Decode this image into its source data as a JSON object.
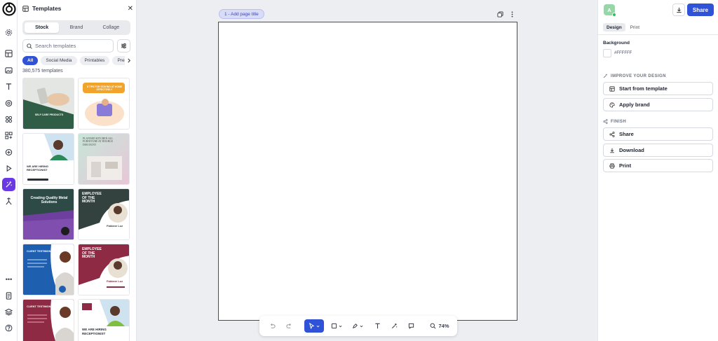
{
  "rail": {
    "items": [
      "settings-icon",
      "layout-icon",
      "image-icon",
      "text-icon",
      "shapes-icon",
      "elements-icon",
      "grid-icon",
      "plus-circle-icon",
      "play-icon",
      "magic-icon",
      "fork-icon"
    ],
    "bottom": [
      "more-icon",
      "pages-icon",
      "layers-icon",
      "help-icon"
    ],
    "more_label": "•••"
  },
  "panel": {
    "title": "Templates",
    "tabs": [
      {
        "label": "Stock"
      },
      {
        "label": "Brand"
      },
      {
        "label": "Collage"
      }
    ],
    "search_placeholder": "Search templates",
    "chips": [
      {
        "label": "All"
      },
      {
        "label": "Social Media"
      },
      {
        "label": "Printables"
      },
      {
        "label": "Presentations"
      }
    ],
    "count": "380,575 templates",
    "tiles": {
      "t1": {
        "caption": "SELF CARE PRODUCTS"
      },
      "t2": {
        "caption": "8 TIPS FOR STAYING AT HOME EFFECTIVELY"
      },
      "t3": {
        "caption": "WE ARE HIRING RECEPTIONIST"
      },
      "t4": {
        "caption": "PLANNED KITCHEN ALL FURNITURE AT DOUBLE DISCOUNT"
      },
      "t5": {
        "caption": "Creating Quality Metal Solutions"
      },
      "t6": {
        "line1": "EMPLOYEE",
        "line2": "OF THE",
        "line3": "MONTH",
        "name": "Fabiane Luz"
      },
      "t7": {
        "caption": "CLIENT TESTIMONIAL"
      },
      "t8": {
        "line1": "EMPLOYEE",
        "line2": "OF THE",
        "line3": "MONTH",
        "name": "Fabiane Luz"
      },
      "t9": {
        "caption": "CLIENT TESTIMONIAL"
      },
      "t10": {
        "line1": "WE ARE HIRING",
        "line2": "RECEPTIONIST"
      }
    }
  },
  "canvas": {
    "page_title": "1 - Add page title",
    "background": "#FFFFFF"
  },
  "toolbar": {
    "zoom": "74%"
  },
  "right": {
    "avatar_initial": "A",
    "share_label": "Share",
    "tabs": [
      {
        "label": "Design"
      },
      {
        "label": "Print"
      }
    ],
    "background_label": "Background",
    "background_hex": "#FFFFFF",
    "improve_heading": "IMPROVE YOUR DESIGN",
    "start_template": "Start from template",
    "apply_brand": "Apply brand",
    "finish_heading": "FINISH",
    "share": "Share",
    "download": "Download",
    "print": "Print"
  },
  "colors": {
    "accent": "#2f52d6",
    "rail_active": "#6a39e6",
    "canvas_border": "#3440c9"
  }
}
